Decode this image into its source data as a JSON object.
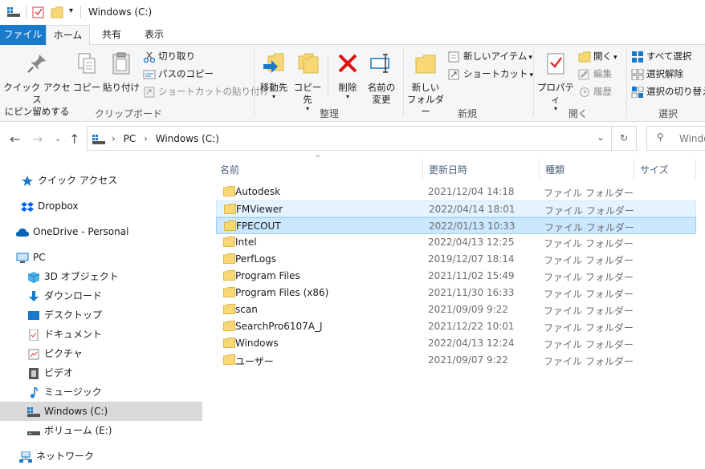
{
  "window": {
    "title": "Windows (C:)"
  },
  "tabs": [
    {
      "label": "ファイル"
    },
    {
      "label": "ホーム"
    },
    {
      "label": "共有"
    },
    {
      "label": "表示"
    }
  ],
  "ribbon": {
    "clipboard": {
      "pin_label_1": "クイック アクセス",
      "pin_label_2": "にピン留めする",
      "copy": "コピー",
      "paste": "貼り付け",
      "cut": "切り取り",
      "copy_path": "パスのコピー",
      "paste_shortcut": "ショートカットの貼り付け",
      "group": "クリップボード"
    },
    "organize": {
      "move": "移動先",
      "copy_to": "コピー先",
      "delete": "削除",
      "rename_1": "名前の",
      "rename_2": "変更",
      "group": "整理"
    },
    "new": {
      "new_folder_1": "新しい",
      "new_folder_2": "フォルダー",
      "new_item": "新しいアイテム",
      "shortcut": "ショートカット",
      "group": "新規"
    },
    "open": {
      "properties": "プロパティ",
      "open": "開く",
      "edit": "編集",
      "history": "履歴",
      "group": "開く"
    },
    "select": {
      "select_all": "すべて選択",
      "select_none": "選択解除",
      "invert": "選択の切り替え",
      "group": "選択"
    }
  },
  "address": {
    "crumbs": [
      "PC",
      "Windows (C:)"
    ],
    "search_placeholder": "Windo"
  },
  "nav": [
    {
      "label": "クイック アクセス",
      "icon": "star-icon"
    },
    {
      "label": "Dropbox",
      "icon": "dropbox-icon"
    },
    {
      "label": "OneDrive - Personal",
      "icon": "cloud-icon"
    },
    {
      "label": "PC",
      "icon": "computer-icon"
    },
    {
      "label": "3D オブジェクト",
      "icon": "cube-icon"
    },
    {
      "label": "ダウンロード",
      "icon": "download-icon"
    },
    {
      "label": "デスクトップ",
      "icon": "desktop-icon"
    },
    {
      "label": "ドキュメント",
      "icon": "document-icon"
    },
    {
      "label": "ピクチャ",
      "icon": "picture-icon"
    },
    {
      "label": "ビデオ",
      "icon": "video-icon"
    },
    {
      "label": "ミュージック",
      "icon": "music-icon"
    },
    {
      "label": "Windows (C:)",
      "icon": "drive-icon"
    },
    {
      "label": "ボリューム (E:)",
      "icon": "drive-icon"
    },
    {
      "label": "ネットワーク",
      "icon": "network-icon"
    }
  ],
  "columns": {
    "name": "名前",
    "date": "更新日時",
    "type": "種類",
    "size": "サイズ"
  },
  "files": [
    {
      "name": "Autodesk",
      "date": "2021/12/04 14:18",
      "type": "ファイル フォルダー"
    },
    {
      "name": "FMViewer",
      "date": "2022/04/14 18:01",
      "type": "ファイル フォルダー"
    },
    {
      "name": "FPECOUT",
      "date": "2022/01/13 10:33",
      "type": "ファイル フォルダー"
    },
    {
      "name": "Intel",
      "date": "2022/04/13 12:25",
      "type": "ファイル フォルダー"
    },
    {
      "name": "PerfLogs",
      "date": "2019/12/07 18:14",
      "type": "ファイル フォルダー"
    },
    {
      "name": "Program Files",
      "date": "2021/11/02 15:49",
      "type": "ファイル フォルダー"
    },
    {
      "name": "Program Files (x86)",
      "date": "2021/11/30 16:33",
      "type": "ファイル フォルダー"
    },
    {
      "name": "scan",
      "date": "2021/09/09 9:22",
      "type": "ファイル フォルダー"
    },
    {
      "name": "SearchPro6107A_J",
      "date": "2021/12/22 10:01",
      "type": "ファイル フォルダー"
    },
    {
      "name": "Windows",
      "date": "2022/04/13 12:24",
      "type": "ファイル フォルダー"
    },
    {
      "name": "ユーザー",
      "date": "2021/09/07 9:22",
      "type": "ファイル フォルダー"
    }
  ],
  "colors": {
    "accent": "#1979ca",
    "selection": "#cce8ff",
    "folder": "#f8d775"
  }
}
